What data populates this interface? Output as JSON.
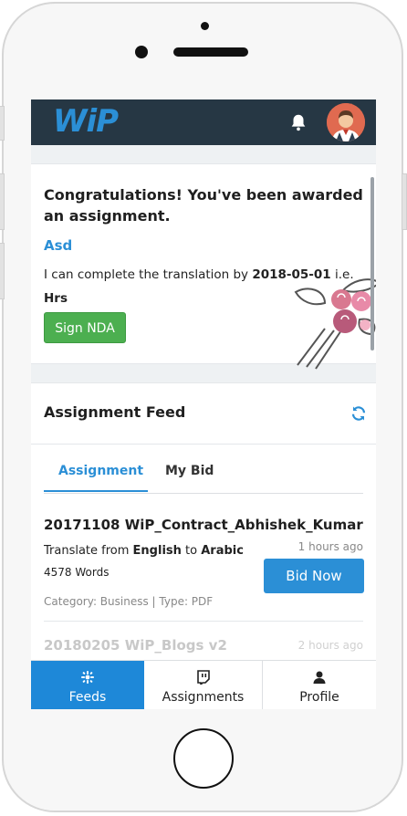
{
  "app": {
    "logo_text": "WiP",
    "brand_color": "#2b8fd6",
    "header_bg": "#263744"
  },
  "header": {
    "notification_icon": "bell-icon",
    "avatar_icon": "user-avatar"
  },
  "award_card": {
    "title": "Congratulations! You've been awarded an assignment.",
    "assignment_name": "Asd",
    "desc_prefix": "I can complete the translation by ",
    "desc_date": "2018-05-01",
    "desc_mid": " i.e. ",
    "desc_hrs": "Hrs",
    "button_label": "Sign NDA",
    "button_color": "#4caf50"
  },
  "feed": {
    "title": "Assignment Feed",
    "refresh_icon": "refresh-icon",
    "tabs": [
      {
        "label": "Assignment",
        "active": true
      },
      {
        "label": "My Bid",
        "active": false
      }
    ],
    "items": [
      {
        "title": "20171108 WiP_Contract_Abhishek_Kumar",
        "time": "1 hours ago",
        "translate_prefix": "Translate from ",
        "from_lang": "English",
        "translate_mid": " to ",
        "to_lang": "Arabic",
        "words": "4578 Words",
        "meta": "Category: Business | Type: PDF",
        "button_label": "Bid Now"
      },
      {
        "title": "20180205 WiP_Blogs v2",
        "time": "2 hours ago"
      }
    ]
  },
  "bottom_nav": [
    {
      "label": "Feeds",
      "icon": "feeds-icon",
      "active": true
    },
    {
      "label": "Assignments",
      "icon": "assignments-icon",
      "active": false
    },
    {
      "label": "Profile",
      "icon": "profile-icon",
      "active": false
    }
  ]
}
